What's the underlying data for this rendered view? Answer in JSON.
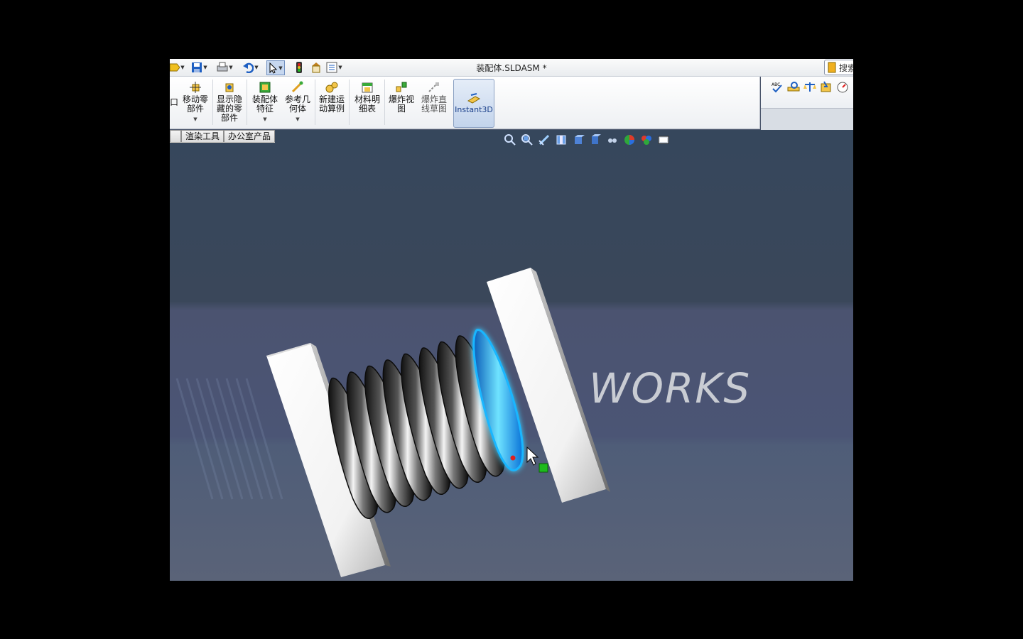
{
  "window": {
    "title": "装配体.SLDASM *",
    "search_label": "搜索"
  },
  "quick_access": {
    "icons": [
      "new-icon",
      "save-icon",
      "print-icon",
      "undo-icon",
      "select-icon",
      "rebuild-icon",
      "file-properties-icon",
      "options-icon"
    ]
  },
  "ribbon": {
    "partial_left_label": "口",
    "buttons": [
      {
        "id": "move-component",
        "label_lines": [
          "移动零",
          "部件"
        ],
        "has_caret": true,
        "icon": "move-component-icon"
      },
      {
        "id": "show-hidden",
        "label_lines": [
          "显示隐",
          "藏的零",
          "部件"
        ],
        "has_caret": false,
        "icon": "show-hidden-icon"
      },
      {
        "id": "assembly-features",
        "label_lines": [
          "装配体",
          "特征"
        ],
        "has_caret": true,
        "icon": "assembly-feature-icon"
      },
      {
        "id": "reference-geometry",
        "label_lines": [
          "参考几",
          "何体"
        ],
        "has_caret": true,
        "icon": "reference-geometry-icon"
      },
      {
        "id": "new-motion-study",
        "label_lines": [
          "新建运",
          "动算例"
        ],
        "has_caret": false,
        "icon": "motion-study-icon"
      },
      {
        "id": "bom",
        "label_lines": [
          "材料明",
          "细表"
        ],
        "has_caret": false,
        "icon": "bom-icon"
      },
      {
        "id": "exploded-view",
        "label_lines": [
          "爆炸视",
          "图"
        ],
        "has_caret": false,
        "icon": "exploded-view-icon"
      },
      {
        "id": "explode-line-sketch",
        "label_lines": [
          "爆炸直",
          "线草图"
        ],
        "has_caret": false,
        "icon": "explode-line-icon"
      }
    ],
    "instant3d_label": "Instant3D",
    "right_icons": [
      "spell-check-icon",
      "measure-icon",
      "mass-properties-icon",
      "section-icon",
      "performance-icon"
    ]
  },
  "tabs": [
    "渲染工具",
    "办公室产品"
  ],
  "viewport": {
    "view_tools": [
      "zoom-to-fit-icon",
      "zoom-area-icon",
      "previous-view-icon",
      "section-view-icon",
      "view-orientation-icon",
      "display-style-icon",
      "hide-show-icon",
      "edit-appearance-icon",
      "apply-scene-icon",
      "view-settings-icon"
    ],
    "watermark": "WORKS",
    "model": {
      "coils": 9,
      "selected_coil": 9
    },
    "colors": {
      "background": "#4a556b",
      "highlight": "#19b6ff",
      "handle": "#1dbb1d",
      "point": "#e02020"
    }
  }
}
